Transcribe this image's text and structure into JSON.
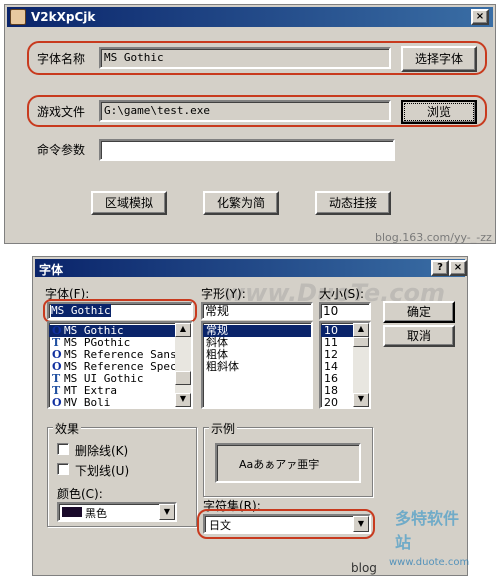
{
  "app_window": {
    "title": "V2kXpCjk",
    "font_name_label": "字体名称",
    "font_name_value": "MS Gothic",
    "choose_font_button": "选择字体",
    "game_file_label": "游戏文件",
    "game_file_value": "G:\\game\\test.exe",
    "browse_button": "浏览",
    "command_args_label": "命令参数",
    "command_args_value": "",
    "region_simulate_button": "区域模拟",
    "trad_to_simp_button": "化繁为简",
    "dynamic_hook_button": "动态挂接",
    "watermark": "blog.163.com/yy-_-zz"
  },
  "font_dialog": {
    "title": "字体",
    "help_button": "?",
    "close_button": "×",
    "font_label": "字体(F):",
    "font_value": "MS Gothic",
    "fonts": [
      {
        "icon": "O",
        "name": "MS Gothic",
        "selected": true
      },
      {
        "icon": "T",
        "name": "MS PGothic",
        "selected": false
      },
      {
        "icon": "O",
        "name": "MS Reference Sans",
        "selected": false
      },
      {
        "icon": "O",
        "name": "MS Reference Speci",
        "selected": false
      },
      {
        "icon": "T",
        "name": "MS UI Gothic",
        "selected": false
      },
      {
        "icon": "T",
        "name": "MT Extra",
        "selected": false
      },
      {
        "icon": "O",
        "name": "MV Boli",
        "selected": false
      }
    ],
    "style_label": "字形(Y):",
    "style_value": "常规",
    "styles": [
      {
        "name": "常规",
        "selected": true
      },
      {
        "name": "斜体",
        "selected": false
      },
      {
        "name": "粗体",
        "selected": false
      },
      {
        "name": "粗斜体",
        "selected": false
      }
    ],
    "size_label": "大小(S):",
    "size_value": "10",
    "sizes": [
      {
        "name": "10",
        "selected": true
      },
      {
        "name": "11",
        "selected": false
      },
      {
        "name": "12",
        "selected": false
      },
      {
        "name": "14",
        "selected": false
      },
      {
        "name": "16",
        "selected": false
      },
      {
        "name": "18",
        "selected": false
      },
      {
        "name": "20",
        "selected": false
      }
    ],
    "ok_button": "确定",
    "cancel_button": "取消",
    "effects_label": "效果",
    "strikeout_label": "删除线(K)",
    "underline_label": "下划线(U)",
    "color_label": "颜色(C):",
    "color_value": "黑色",
    "sample_label": "示例",
    "sample_text": "Aaあぁアァ亜宇",
    "charset_label": "字符集(R):",
    "charset_value": "日文",
    "watermark_top": "www.DuoTe.com",
    "watermark_bottom": "blog",
    "watermark_logo": "多特软件站",
    "watermark_logo_url": "www.duote.com"
  }
}
